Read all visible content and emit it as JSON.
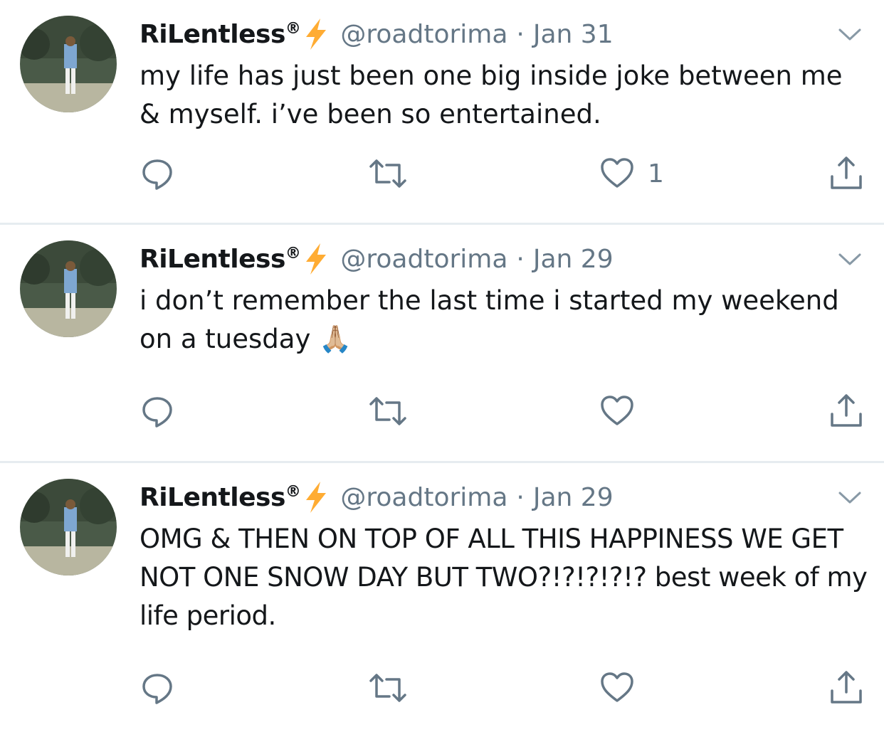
{
  "tweets": [
    {
      "author_name": "RiLentless",
      "registered_mark": "®",
      "handle": "@roadtorima",
      "separator": "·",
      "date": "Jan 31",
      "text": "my life has just been one big inside joke between me & myself. i’ve been so entertained.",
      "like_count": "1"
    },
    {
      "author_name": "RiLentless",
      "registered_mark": "®",
      "handle": "@roadtorima",
      "separator": "·",
      "date": "Jan 29",
      "text": "i don’t remember the last time i started my weekend on a tuesday 🙏🏼",
      "like_count": ""
    },
    {
      "author_name": "RiLentless",
      "registered_mark": "®",
      "handle": "@roadtorima",
      "separator": "·",
      "date": "Jan 29",
      "text": "OMG & THEN ON TOP OF ALL THIS HAPPINESS WE GET NOT ONE SNOW DAY BUT TWO?!?!?!?!? best week of my life period.",
      "like_count": ""
    }
  ],
  "colors": {
    "name_text": "#14171a",
    "secondary_text": "#657786",
    "icon_gray": "#657786",
    "divider": "#e6ecf0",
    "bolt": "#ffac33"
  },
  "icons": [
    "lightning-bolt-icon",
    "chevron-down-icon",
    "reply-icon",
    "retweet-icon",
    "heart-icon",
    "share-icon"
  ]
}
